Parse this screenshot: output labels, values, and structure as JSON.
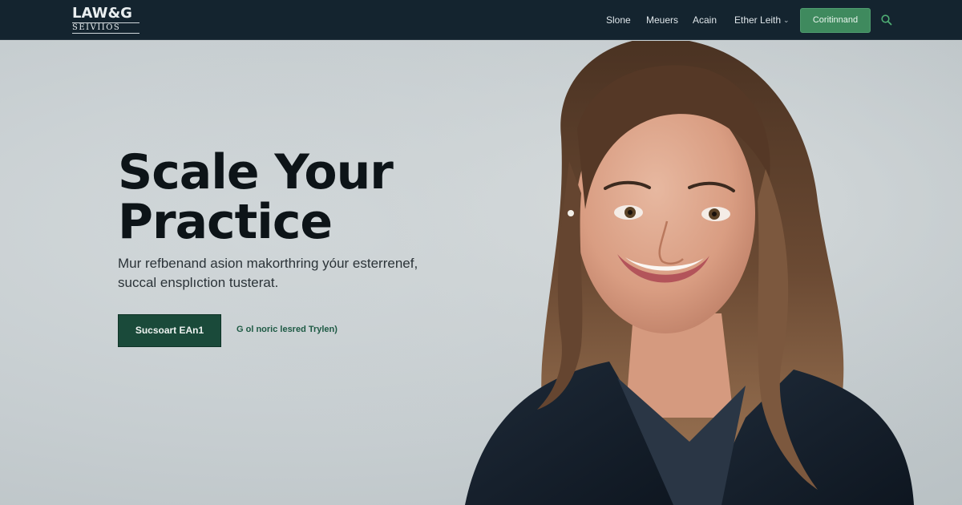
{
  "nav": {
    "logo_line1": "LAW&G",
    "logo_line2": "SEIVIIOS",
    "links": [
      "Slone",
      "Meuers",
      "Acain",
      "Ether Leith"
    ],
    "dropdown_icon": "chevron-down-icon",
    "cta_label": "Coritinnand",
    "search_icon": "search-icon"
  },
  "hero": {
    "headline_line1": "Scale Your",
    "headline_line2": "Practice",
    "subtext_line1": "Mur refbenand asion makorthring yóur esterrenef,",
    "subtext_line2": "succal ensplıction tusterat.",
    "primary_button": "Sucsoart EAn1",
    "secondary_link": "G ol noric lesred Trylen)",
    "photo_alt": "portrait of smiling woman in dark blazer"
  },
  "colors": {
    "navbar_bg": "#14242f",
    "accent_green": "#3f8a5e",
    "primary_button_bg": "#1a4a3a",
    "hero_bg": "#c9d0d2",
    "headline": "#0d1418"
  }
}
